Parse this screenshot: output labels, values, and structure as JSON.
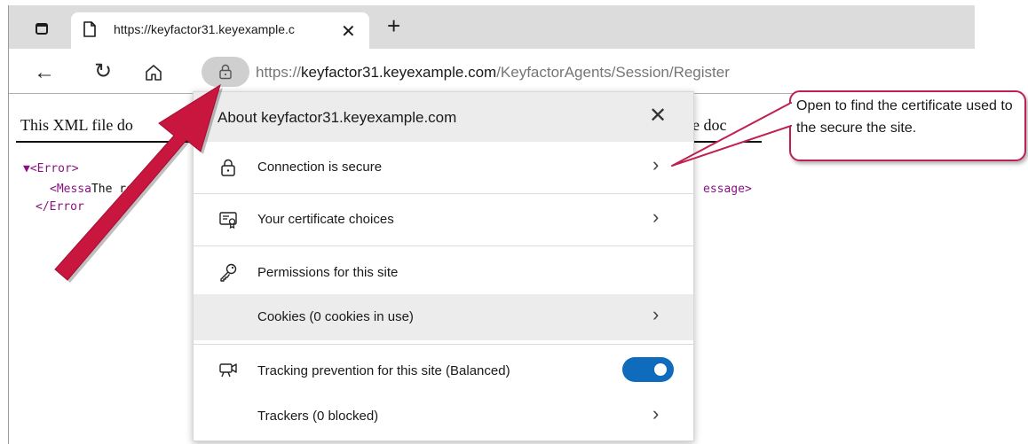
{
  "tab": {
    "title": "https://keyfactor31.keyexample.c",
    "close_glyph": "✕",
    "new_tab_glyph": "+"
  },
  "toolbar": {
    "back_glyph": "←",
    "refresh_glyph": "↻",
    "url_prefix": "https://",
    "url_host": "keyfactor31.keyexample.com",
    "url_path": "/KeyfactorAgents/Session/Register"
  },
  "page": {
    "heading_left": "This XML file do",
    "heading_right": "e doc",
    "xml_open": "▼<Error>",
    "xml_message_open": "<Messa",
    "xml_message_text": "The rec",
    "xml_message_close": "essage>",
    "xml_close": "</Error"
  },
  "flyout": {
    "title": "About keyfactor31.keyexample.com",
    "close_glyph": "✕",
    "rows": [
      {
        "label": "Connection is secure",
        "icon": "lock-icon"
      },
      {
        "label": "Your certificate choices",
        "icon": "certificate-icon"
      },
      {
        "label": "Permissions for this site",
        "icon": "key-icon"
      },
      {
        "label": "Cookies (0 cookies in use)",
        "icon": ""
      },
      {
        "label": "Tracking prevention for this site (Balanced)",
        "icon": "tracking-icon",
        "toggle_on": true
      },
      {
        "label": "Trackers (0 blocked)",
        "icon": ""
      }
    ],
    "chevron_glyph": "›"
  },
  "callout": {
    "text": "Open to find the certificate used to the secure the site."
  },
  "colors": {
    "accent": "#c8163f",
    "toggle": "#0f6cbd",
    "callout_border": "#c02050"
  }
}
